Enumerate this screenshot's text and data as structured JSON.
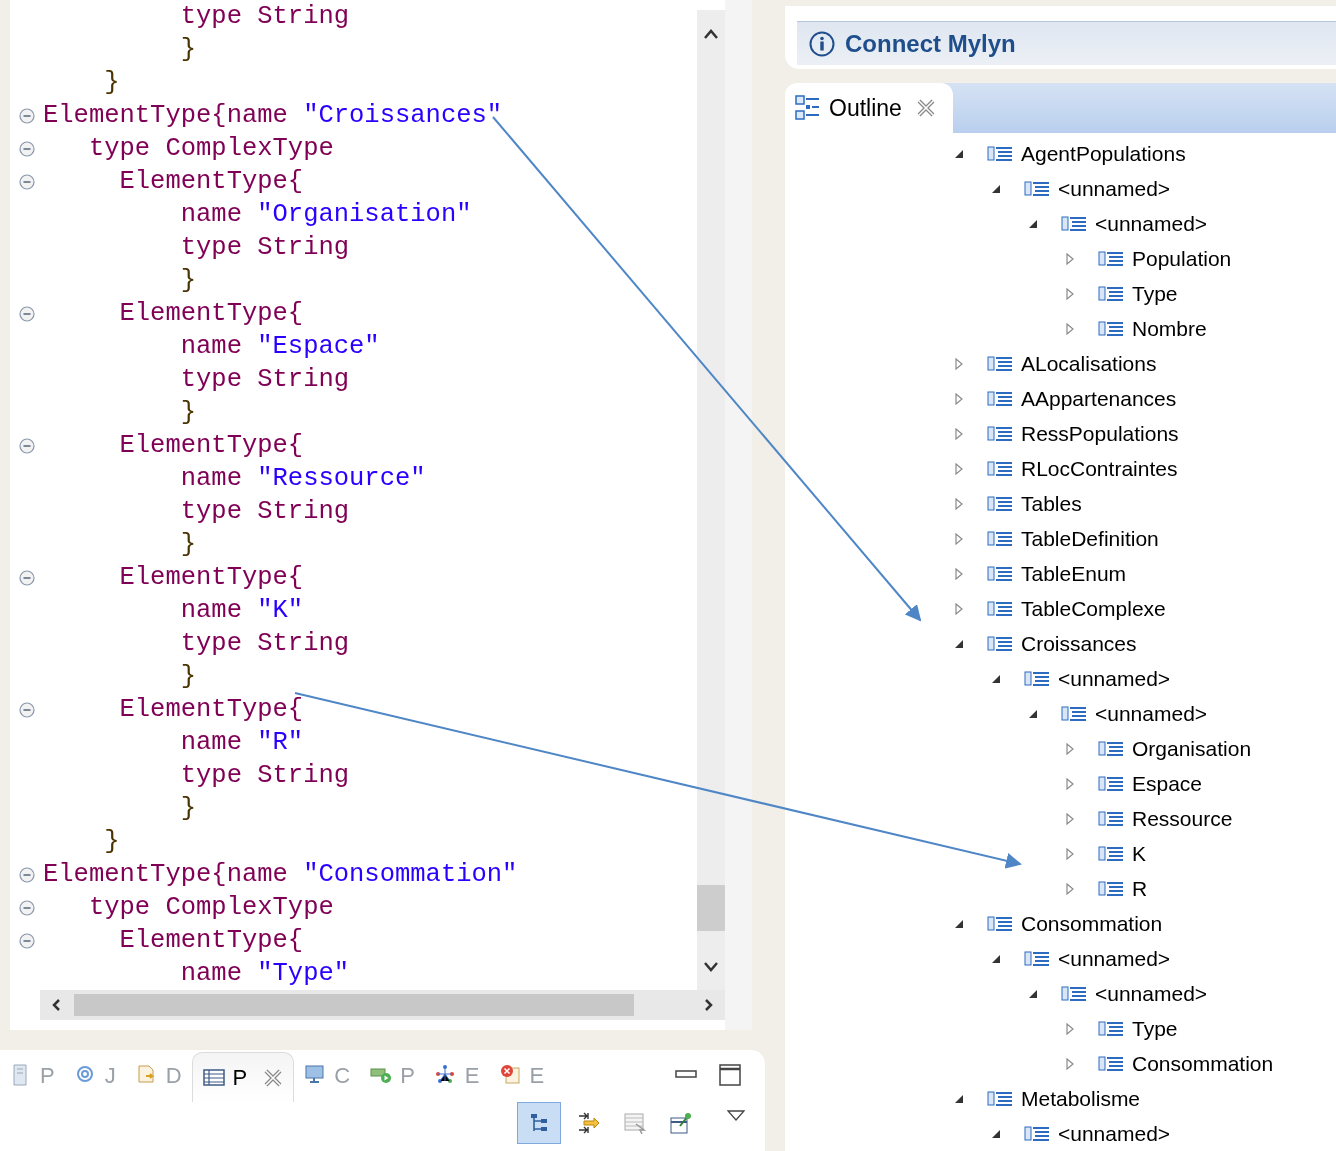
{
  "editor": {
    "lines": [
      {
        "foldable": false,
        "segments": [
          {
            "kind": "kw",
            "text": "         type String"
          }
        ]
      },
      {
        "foldable": false,
        "segments": [
          {
            "kind": "brace",
            "text": "         }"
          }
        ]
      },
      {
        "foldable": false,
        "segments": [
          {
            "kind": "brace",
            "text": "    }"
          }
        ]
      },
      {
        "foldable": true,
        "segments": [
          {
            "kind": "kw",
            "text": "ElementType{name "
          },
          {
            "kind": "str",
            "text": "\"Croissances\""
          }
        ]
      },
      {
        "foldable": true,
        "segments": [
          {
            "kind": "kw",
            "text": "   type ComplexType"
          }
        ]
      },
      {
        "foldable": true,
        "segments": [
          {
            "kind": "kw",
            "text": "     ElementType{"
          }
        ]
      },
      {
        "foldable": false,
        "segments": [
          {
            "kind": "kw",
            "text": "         name "
          },
          {
            "kind": "str",
            "text": "\"Organisation\""
          }
        ]
      },
      {
        "foldable": false,
        "segments": [
          {
            "kind": "kw",
            "text": "         type String"
          }
        ]
      },
      {
        "foldable": false,
        "segments": [
          {
            "kind": "brace",
            "text": "         }"
          }
        ]
      },
      {
        "foldable": true,
        "segments": [
          {
            "kind": "kw",
            "text": "     ElementType{"
          }
        ]
      },
      {
        "foldable": false,
        "segments": [
          {
            "kind": "kw",
            "text": "         name "
          },
          {
            "kind": "str",
            "text": "\"Espace\""
          }
        ]
      },
      {
        "foldable": false,
        "segments": [
          {
            "kind": "kw",
            "text": "         type String"
          }
        ]
      },
      {
        "foldable": false,
        "segments": [
          {
            "kind": "brace",
            "text": "         }"
          }
        ]
      },
      {
        "foldable": true,
        "segments": [
          {
            "kind": "kw",
            "text": "     ElementType{"
          }
        ]
      },
      {
        "foldable": false,
        "segments": [
          {
            "kind": "kw",
            "text": "         name "
          },
          {
            "kind": "str",
            "text": "\"Ressource\""
          }
        ]
      },
      {
        "foldable": false,
        "segments": [
          {
            "kind": "kw",
            "text": "         type String"
          }
        ]
      },
      {
        "foldable": false,
        "segments": [
          {
            "kind": "brace",
            "text": "         }"
          }
        ]
      },
      {
        "foldable": true,
        "segments": [
          {
            "kind": "kw",
            "text": "     ElementType{"
          }
        ]
      },
      {
        "foldable": false,
        "segments": [
          {
            "kind": "kw",
            "text": "         name "
          },
          {
            "kind": "str",
            "text": "\"K\""
          }
        ]
      },
      {
        "foldable": false,
        "segments": [
          {
            "kind": "kw",
            "text": "         type String"
          }
        ]
      },
      {
        "foldable": false,
        "segments": [
          {
            "kind": "brace",
            "text": "         }"
          }
        ]
      },
      {
        "foldable": true,
        "segments": [
          {
            "kind": "kw",
            "text": "     ElementType{"
          }
        ]
      },
      {
        "foldable": false,
        "segments": [
          {
            "kind": "kw",
            "text": "         name "
          },
          {
            "kind": "str",
            "text": "\"R\""
          }
        ]
      },
      {
        "foldable": false,
        "segments": [
          {
            "kind": "kw",
            "text": "         type String"
          }
        ]
      },
      {
        "foldable": false,
        "segments": [
          {
            "kind": "brace",
            "text": "         }"
          }
        ]
      },
      {
        "foldable": false,
        "segments": [
          {
            "kind": "brace",
            "text": "    }"
          }
        ]
      },
      {
        "foldable": true,
        "segments": [
          {
            "kind": "kw",
            "text": "ElementType{name "
          },
          {
            "kind": "str",
            "text": "\"Consommation\""
          }
        ]
      },
      {
        "foldable": true,
        "segments": [
          {
            "kind": "kw",
            "text": "   type ComplexType"
          }
        ]
      },
      {
        "foldable": true,
        "segments": [
          {
            "kind": "kw",
            "text": "     ElementType{"
          }
        ]
      },
      {
        "foldable": false,
        "segments": [
          {
            "kind": "kw",
            "text": "         name "
          },
          {
            "kind": "str",
            "text": "\"Type\""
          }
        ]
      }
    ]
  },
  "bottom_panel": {
    "tabs": [
      {
        "label": "P",
        "selected": false
      },
      {
        "label": "J",
        "selected": false
      },
      {
        "label": "D",
        "selected": false
      },
      {
        "label": "P",
        "selected": true
      },
      {
        "label": "C",
        "selected": false
      },
      {
        "label": "P",
        "selected": false
      },
      {
        "label": "E",
        "selected": false
      },
      {
        "label": "E",
        "selected": false
      }
    ],
    "toolbar": [
      {
        "selected": true
      },
      {
        "selected": false
      },
      {
        "selected": false
      },
      {
        "selected": false
      }
    ]
  },
  "mylyn": {
    "title": "Connect Mylyn"
  },
  "outline": {
    "tab": {
      "label": "Outline",
      "selected": true
    },
    "tree": [
      {
        "label": "AgentPopulations",
        "expanded": true,
        "children": [
          {
            "label": "<unnamed>",
            "expanded": true,
            "children": [
              {
                "label": "<unnamed>",
                "expanded": true,
                "children": [
                  {
                    "label": "Population",
                    "expanded": false
                  },
                  {
                    "label": "Type",
                    "expanded": false
                  },
                  {
                    "label": "Nombre",
                    "expanded": false
                  }
                ]
              }
            ]
          }
        ]
      },
      {
        "label": "ALocalisations",
        "expanded": false
      },
      {
        "label": "AAppartenances",
        "expanded": false
      },
      {
        "label": "RessPopulations",
        "expanded": false
      },
      {
        "label": "RLocContraintes",
        "expanded": false
      },
      {
        "label": "Tables",
        "expanded": false
      },
      {
        "label": "TableDefinition",
        "expanded": false
      },
      {
        "label": "TableEnum",
        "expanded": false
      },
      {
        "label": "TableComplexe",
        "expanded": false
      },
      {
        "label": "Croissances",
        "expanded": true,
        "children": [
          {
            "label": "<unnamed>",
            "expanded": true,
            "children": [
              {
                "label": "<unnamed>",
                "expanded": true,
                "children": [
                  {
                    "label": "Organisation",
                    "expanded": false
                  },
                  {
                    "label": "Espace",
                    "expanded": false
                  },
                  {
                    "label": "Ressource",
                    "expanded": false
                  },
                  {
                    "label": "K",
                    "expanded": false
                  },
                  {
                    "label": "R",
                    "expanded": false
                  }
                ]
              }
            ]
          }
        ]
      },
      {
        "label": "Consommation",
        "expanded": true,
        "children": [
          {
            "label": "<unnamed>",
            "expanded": true,
            "children": [
              {
                "label": "<unnamed>",
                "expanded": true,
                "children": [
                  {
                    "label": "Type",
                    "expanded": false
                  },
                  {
                    "label": "Consommation",
                    "expanded": false
                  }
                ]
              }
            ]
          }
        ]
      },
      {
        "label": "Metabolisme",
        "expanded": true,
        "children": [
          {
            "label": "<unnamed>",
            "expanded": true
          }
        ]
      }
    ]
  }
}
